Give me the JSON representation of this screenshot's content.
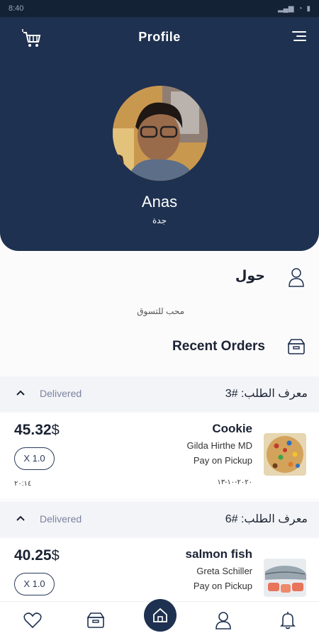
{
  "status_bar": {
    "time": "8:40"
  },
  "header": {
    "title": "Profile"
  },
  "profile": {
    "name": "Anas",
    "city": "جدة"
  },
  "about": {
    "label": "حول",
    "text": "محب للتسوق"
  },
  "recent_orders": {
    "title": "Recent Orders",
    "orders": [
      {
        "status": "Delivered",
        "order_id": "معرف الطلب: #3",
        "price": "45.32",
        "currency": "$",
        "quantity": "X 1.0",
        "time": "٢٠:١٤",
        "product": "Cookie",
        "seller": "Gilda Hirthe MD",
        "payment": "Pay on Pickup",
        "date": "٢٠٢٠-١٠-١٣"
      },
      {
        "status": "Delivered",
        "order_id": "معرف الطلب: #6",
        "price": "40.25",
        "currency": "$",
        "quantity": "X 1.0",
        "product": "salmon fish",
        "seller": "Greta Schiller",
        "payment": "Pay on Pickup"
      }
    ]
  },
  "icons": {
    "cart": "cart-icon",
    "menu": "menu-icon",
    "about": "user-icon",
    "orders": "box-icon",
    "favorites": "heart-icon",
    "home": "home-icon",
    "profile": "user-icon",
    "notifications": "bell-icon"
  },
  "colors": {
    "primary": "#1f3150",
    "status_muted": "#7a83a0",
    "background": "#fbfbfc"
  }
}
